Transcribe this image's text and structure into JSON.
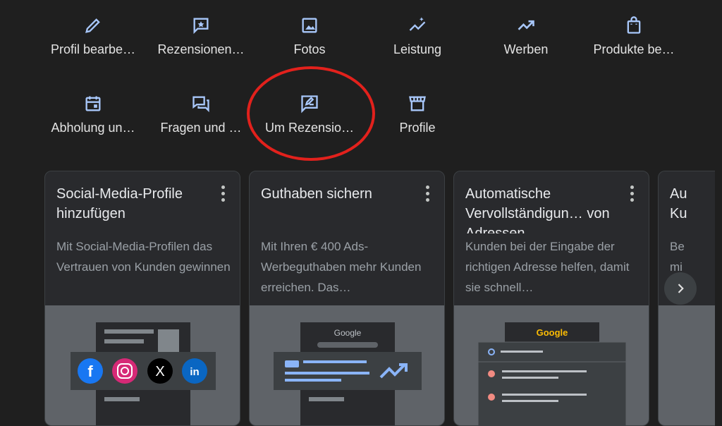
{
  "quick_actions": [
    {
      "label": "Profil bearbe…",
      "icon": "pencil-icon"
    },
    {
      "label": "Rezensionen…",
      "icon": "review-star-icon"
    },
    {
      "label": "Fotos",
      "icon": "photo-icon"
    },
    {
      "label": "Leistung",
      "icon": "performance-sparkle-icon"
    },
    {
      "label": "Werben",
      "icon": "trending-up-icon"
    },
    {
      "label": "Produkte be…",
      "icon": "shopping-bag-icon"
    },
    {
      "label": "Abholung un…",
      "icon": "calendar-icon"
    },
    {
      "label": "Fragen und …",
      "icon": "forum-icon"
    },
    {
      "label": "Um Rezensio…",
      "icon": "rate-review-icon"
    },
    {
      "label": "Profile",
      "icon": "storefront-icon"
    }
  ],
  "cards": [
    {
      "title": "Social-Media-Profile hinzufügen",
      "description": "Mit Social-Media-Profilen das Vertrauen von Kunden gewinnen"
    },
    {
      "title": "Guthaben sichern",
      "description": "Mit Ihren € 400 Ads-Werbeguthaben mehr Kunden erreichen. Das…",
      "illustration_label": "Google"
    },
    {
      "title": "Automatische Vervollständigun… von Adressen",
      "description": "Kunden bei der Eingabe der richtigen Adresse helfen, damit sie schnell…",
      "illustration_label": "Google"
    },
    {
      "title": "Au Ku",
      "description": "Be mi"
    }
  ],
  "accent_color": "#e2211c",
  "social_icons": [
    "facebook-icon",
    "instagram-icon",
    "x-icon",
    "linkedin-icon"
  ]
}
